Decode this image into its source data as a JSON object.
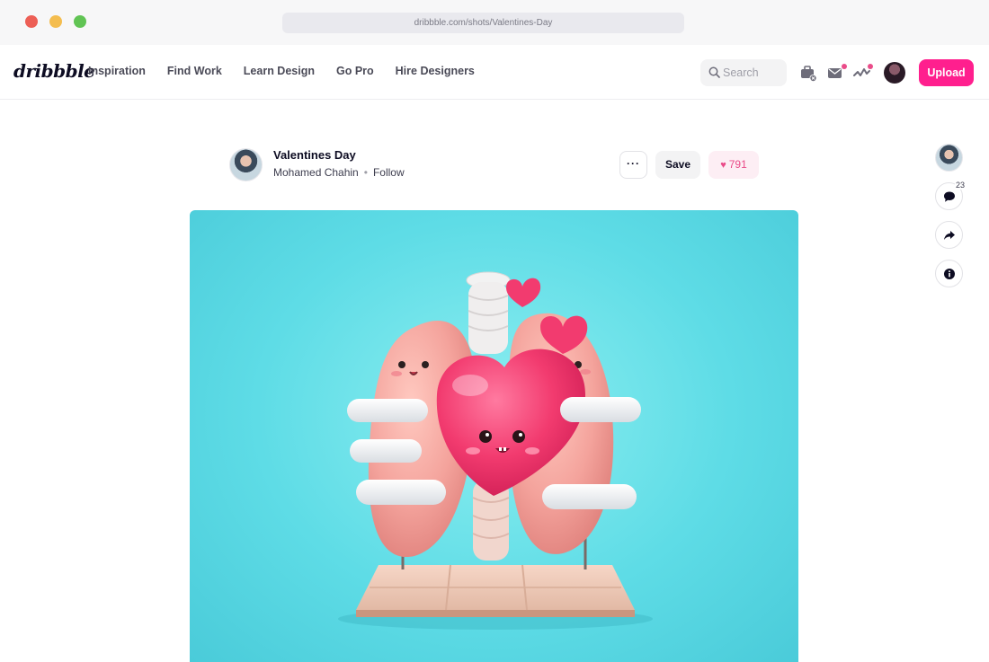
{
  "browser": {
    "url": "dribbble.com/shots/Valentines-Day"
  },
  "nav": {
    "logo": "dribbble",
    "links": [
      "Inspiration",
      "Find Work",
      "Learn Design",
      "Go Pro",
      "Hire Designers"
    ],
    "search_placeholder": "Search",
    "upload_label": "Upload"
  },
  "shot": {
    "title": "Valentines Day",
    "author": "Mohamed Chahin",
    "follow_label": "Follow",
    "more_label": "···",
    "save_label": "Save",
    "likes": "791"
  },
  "rail": {
    "comments_count": "23"
  },
  "colors": {
    "brand_pink": "#ff1f8e",
    "like_pink": "#ea4c89",
    "image_bg": "#5edce6"
  }
}
